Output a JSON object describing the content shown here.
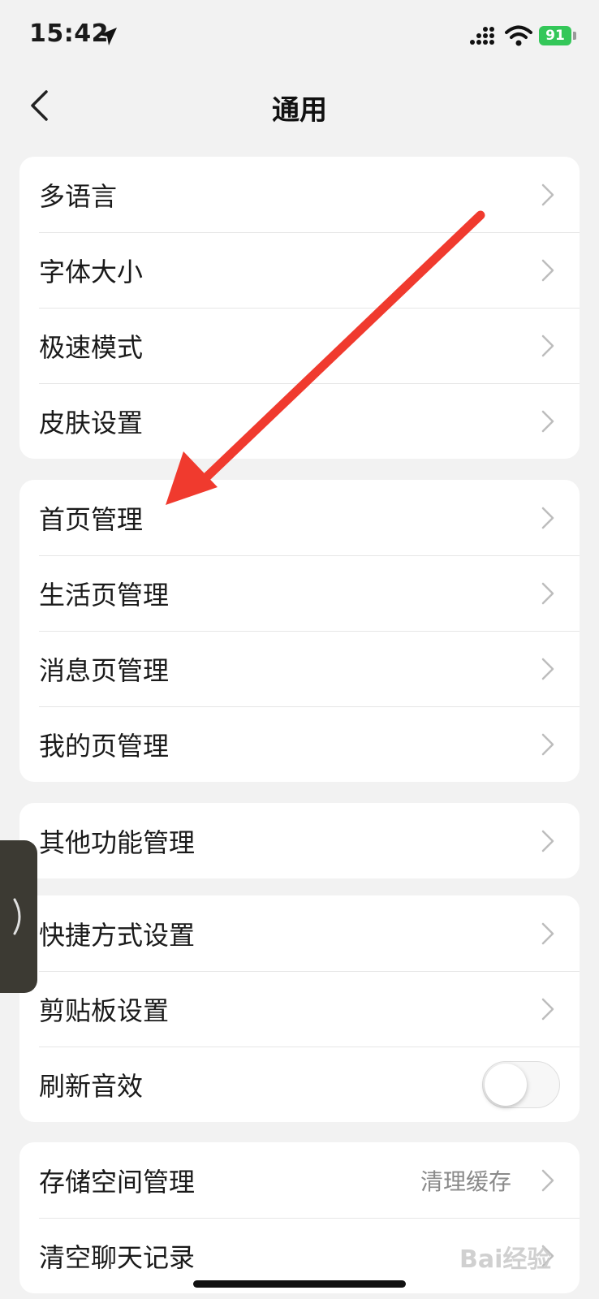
{
  "status_bar": {
    "time": "15:42",
    "battery": "91"
  },
  "nav": {
    "title": "通用"
  },
  "groups": [
    {
      "items": [
        {
          "label": "多语言"
        },
        {
          "label": "字体大小"
        },
        {
          "label": "极速模式"
        },
        {
          "label": "皮肤设置"
        }
      ]
    },
    {
      "items": [
        {
          "label": "首页管理"
        },
        {
          "label": "生活页管理"
        },
        {
          "label": "消息页管理"
        },
        {
          "label": "我的页管理"
        }
      ]
    },
    {
      "items": [
        {
          "label": "其他功能管理"
        }
      ]
    },
    {
      "items": [
        {
          "label": "快捷方式设置"
        },
        {
          "label": "剪贴板设置"
        },
        {
          "label": "刷新音效",
          "toggle": false
        }
      ]
    },
    {
      "items": [
        {
          "label": "存储空间管理",
          "value": "清理缓存"
        },
        {
          "label": "清空聊天记录"
        }
      ]
    }
  ],
  "annotation": {
    "arrow_color": "#f03a2e"
  },
  "watermark": "Bai经验"
}
